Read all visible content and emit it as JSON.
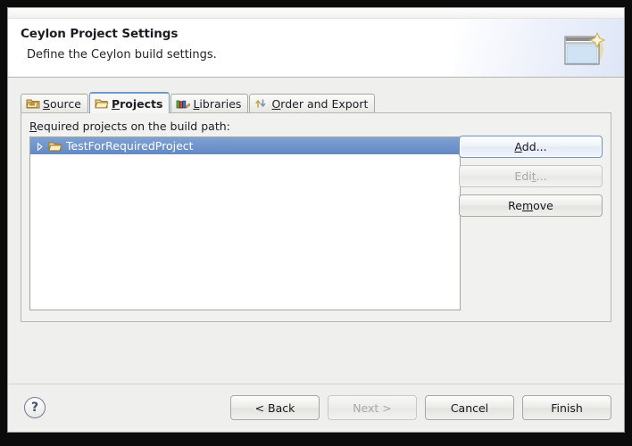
{
  "window": {
    "header": {
      "title": "Ceylon Project Settings",
      "description": "Define the Ceylon build settings.",
      "banner_icon": "wizard-window-sparkle-icon"
    }
  },
  "tabs": [
    {
      "label_pre": "",
      "mnemonic": "S",
      "label_post": "ource",
      "icon": "package-folder-icon",
      "active": false,
      "name": "tab-source"
    },
    {
      "label_pre": "",
      "mnemonic": "P",
      "label_post": "rojects",
      "icon": "open-folder-icon",
      "active": true,
      "name": "tab-projects"
    },
    {
      "label_pre": "",
      "mnemonic": "L",
      "label_post": "ibraries",
      "icon": "books-icon",
      "active": false,
      "name": "tab-libraries"
    },
    {
      "label_pre": "",
      "mnemonic": "O",
      "label_post": "rder and Export",
      "icon": "order-arrows-icon",
      "active": false,
      "name": "tab-order-and-export"
    }
  ],
  "panel": {
    "list_label_pre": "",
    "list_label_mnemonic": "R",
    "list_label_post": "equired projects on the build path:",
    "list_items": [
      {
        "label": "TestForRequiredProject",
        "icon": "open-folder-icon",
        "expander": "collapsed-triangle-icon",
        "selected": true
      }
    ],
    "side_buttons": [
      {
        "pre": "",
        "mnemonic": "A",
        "post": "dd...",
        "state": "focused",
        "name": "add-button"
      },
      {
        "pre": "Edi",
        "mnemonic": "t",
        "post": "...",
        "state": "disabled",
        "name": "edit-button"
      },
      {
        "pre": "Re",
        "mnemonic": "m",
        "post": "ove",
        "state": "normal",
        "name": "remove-button"
      }
    ]
  },
  "footer": {
    "help_label": "?",
    "nav_buttons": [
      {
        "label": "< Back",
        "state": "normal",
        "name": "back-button"
      },
      {
        "label": "Next >",
        "state": "disabled",
        "name": "next-button"
      },
      {
        "label": "Cancel",
        "state": "normal",
        "name": "cancel-button"
      },
      {
        "label": "Finish",
        "state": "normal",
        "name": "finish-button"
      }
    ]
  },
  "colors": {
    "selection_blue": "#6b90c9",
    "focus_border": "#6f92c4",
    "dialog_bg": "#efefed",
    "header_bg": "#ffffff"
  }
}
